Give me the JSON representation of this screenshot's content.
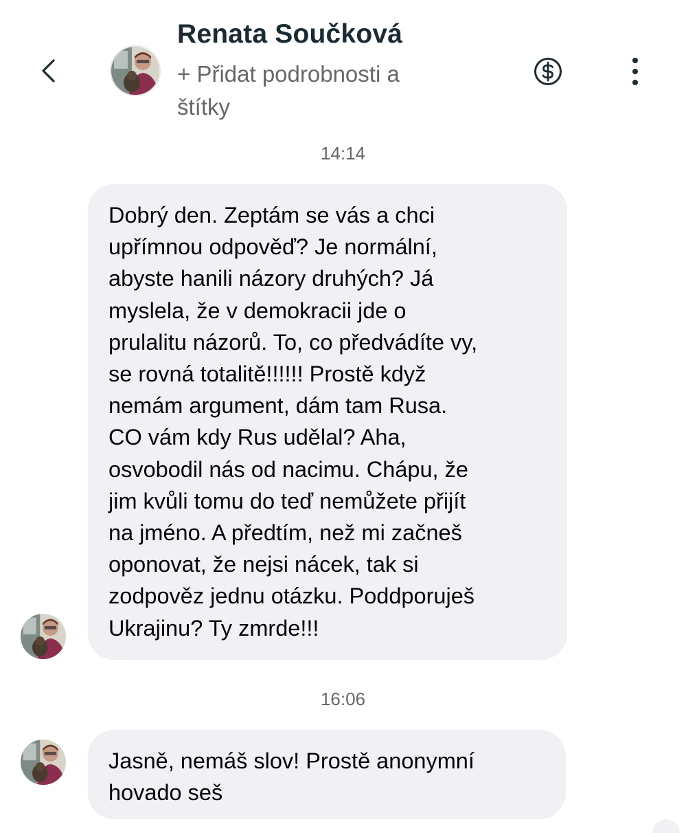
{
  "header": {
    "contact_name": "Renata Součková",
    "add_details_line1": "+ Přidat podrobnosti a",
    "add_details_line2": "štítky",
    "back_icon": "chevron-left-icon",
    "payment_icon": "dollar-circle-icon",
    "more_icon": "more-vertical-icon"
  },
  "conversation": [
    {
      "time": "14:14",
      "sender": "Renata Součková",
      "lines": [
        "Dobrý den. Zeptám se vás a chci",
        "upřímnou odpověď? Je normální,",
        "abyste hanili názory druhých? Já",
        "myslela, že v demokracii jde o",
        "prulalitu názorů. To, co předvádíte vy,",
        "se rovná totalitě!!!!!! Prostě když",
        "nemám argument, dám tam Rusa.",
        "CO vám kdy Rus udělal? Aha,",
        "osvobodil nás od nacimu. Chápu, že",
        "jim kvůli tomu do teď nemůžete přijít",
        "na jméno. A předtím, než mi začneš",
        "oponovat, že nejsi nácek, tak si",
        "zodpověz jednu otázku. Poddporuješ",
        "Ukrajinu? Ty zmrde!!!"
      ]
    },
    {
      "time": "16:06",
      "sender": "Renata Součková",
      "lines": [
        "Jasně, nemáš slov! Prostě anonymní",
        "hovado seš"
      ]
    }
  ],
  "colors": {
    "bubble": "#f0f0f5",
    "secondary_text": "#65676b",
    "name_text": "#1c2b33"
  }
}
